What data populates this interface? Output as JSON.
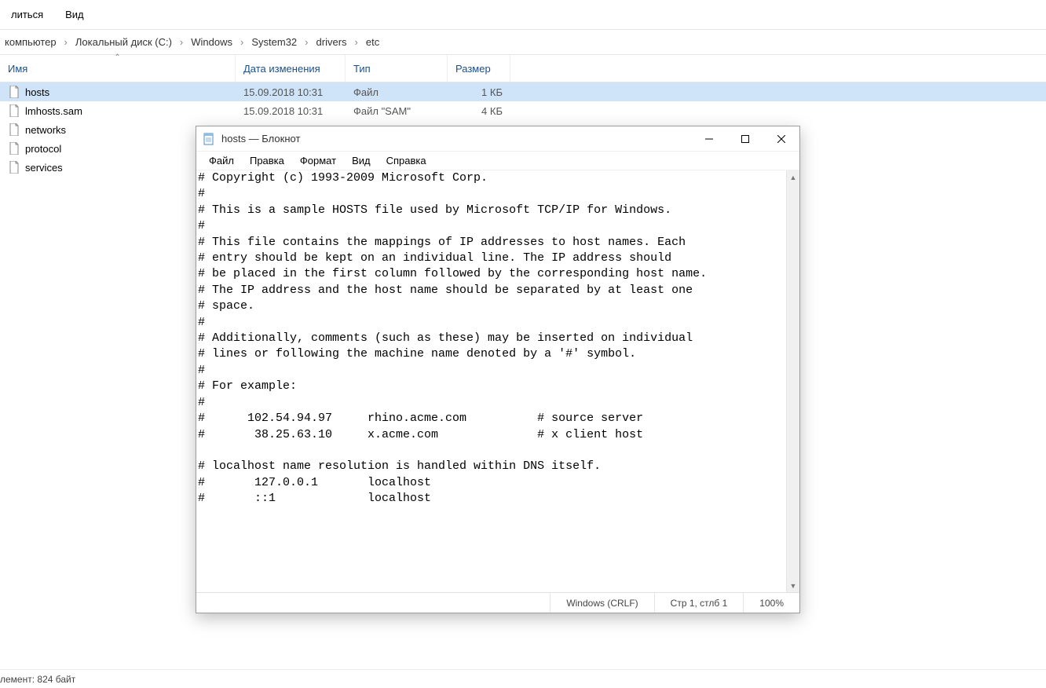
{
  "explorer": {
    "menu": [
      "литься",
      "Вид"
    ],
    "breadcrumb": [
      "компьютер",
      "Локальный диск (C:)",
      "Windows",
      "System32",
      "drivers",
      "etc"
    ],
    "columns": {
      "name": "Имя",
      "date": "Дата изменения",
      "type": "Тип",
      "size": "Размер"
    },
    "files": [
      {
        "name": "hosts",
        "date": "15.09.2018 10:31",
        "type": "Файл",
        "size": "1 КБ",
        "selected": true
      },
      {
        "name": "lmhosts.sam",
        "date": "15.09.2018 10:31",
        "type": "Файл \"SAM\"",
        "size": "4 КБ",
        "selected": false
      },
      {
        "name": "networks",
        "date": "",
        "type": "",
        "size": "",
        "selected": false
      },
      {
        "name": "protocol",
        "date": "",
        "type": "",
        "size": "",
        "selected": false
      },
      {
        "name": "services",
        "date": "",
        "type": "",
        "size": "",
        "selected": false
      }
    ],
    "status": "лемент: 824 байт"
  },
  "notepad": {
    "title": "hosts — Блокнот",
    "menu": [
      "Файл",
      "Правка",
      "Формат",
      "Вид",
      "Справка"
    ],
    "content": "# Copyright (c) 1993-2009 Microsoft Corp.\n#\n# This is a sample HOSTS file used by Microsoft TCP/IP for Windows.\n#\n# This file contains the mappings of IP addresses to host names. Each\n# entry should be kept on an individual line. The IP address should\n# be placed in the first column followed by the corresponding host name.\n# The IP address and the host name should be separated by at least one\n# space.\n#\n# Additionally, comments (such as these) may be inserted on individual\n# lines or following the machine name denoted by a '#' symbol.\n#\n# For example:\n#\n#      102.54.94.97     rhino.acme.com          # source server\n#       38.25.63.10     x.acme.com              # x client host\n\n# localhost name resolution is handled within DNS itself.\n#       127.0.0.1       localhost\n#       ::1             localhost",
    "status": {
      "encoding": "Windows (CRLF)",
      "cursor": "Стр 1, стлб 1",
      "zoom": "100%"
    }
  }
}
